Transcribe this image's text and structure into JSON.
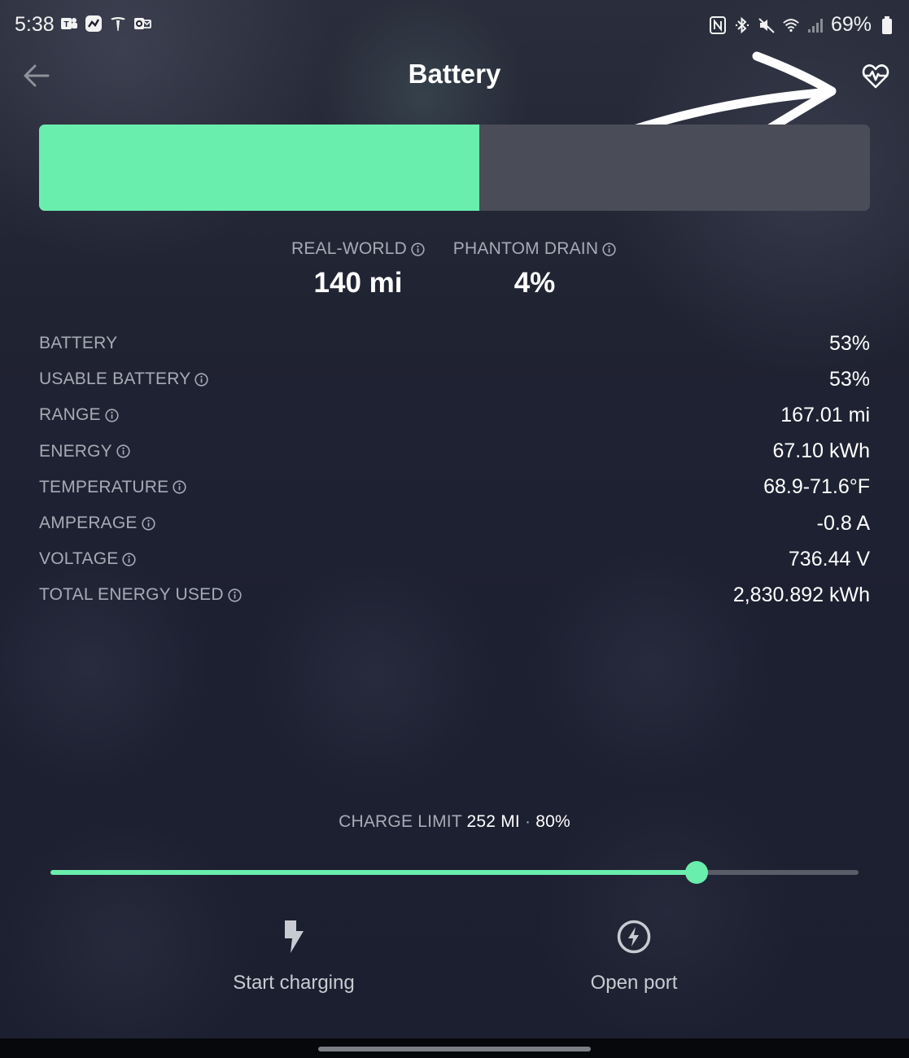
{
  "status_bar": {
    "time": "5:38",
    "battery_percent": "69%"
  },
  "header": {
    "title": "Battery"
  },
  "battery": {
    "level_percent": 53,
    "fill_color": "#69eeae",
    "track_color": "#4a4c57"
  },
  "summary": {
    "real_world_label": "REAL-WORLD",
    "real_world_value": "140 mi",
    "phantom_drain_label": "PHANTOM DRAIN",
    "phantom_drain_value": "4%"
  },
  "details": [
    {
      "label": "BATTERY",
      "value": "53%",
      "info": false
    },
    {
      "label": "USABLE BATTERY",
      "value": "53%",
      "info": true
    },
    {
      "label": "RANGE",
      "value": "167.01 mi",
      "info": true
    },
    {
      "label": "ENERGY",
      "value": "67.10 kWh",
      "info": true
    },
    {
      "label": "TEMPERATURE",
      "value": "68.9-71.6°F",
      "info": true
    },
    {
      "label": "AMPERAGE",
      "value": "-0.8 A",
      "info": true
    },
    {
      "label": "VOLTAGE",
      "value": "736.44 V",
      "info": true
    },
    {
      "label": "TOTAL ENERGY USED",
      "value": "2,830.892 kWh",
      "info": true
    }
  ],
  "charge_limit": {
    "label": "CHARGE LIMIT",
    "miles": "252 MI",
    "separator": "·",
    "percent_text": "80%",
    "percent": 80,
    "slider_color": "#69eeae"
  },
  "actions": {
    "start_charging": "Start charging",
    "open_port": "Open port"
  },
  "icons": {
    "back": "back-arrow-icon",
    "health": "heart-pulse-icon",
    "info": "info-circle-icon",
    "charge": "lightning-bolt-icon",
    "port": "charge-port-icon"
  },
  "colors": {
    "accent": "#69eeae",
    "label": "#a8abb5",
    "background": "#1c1f2e"
  }
}
